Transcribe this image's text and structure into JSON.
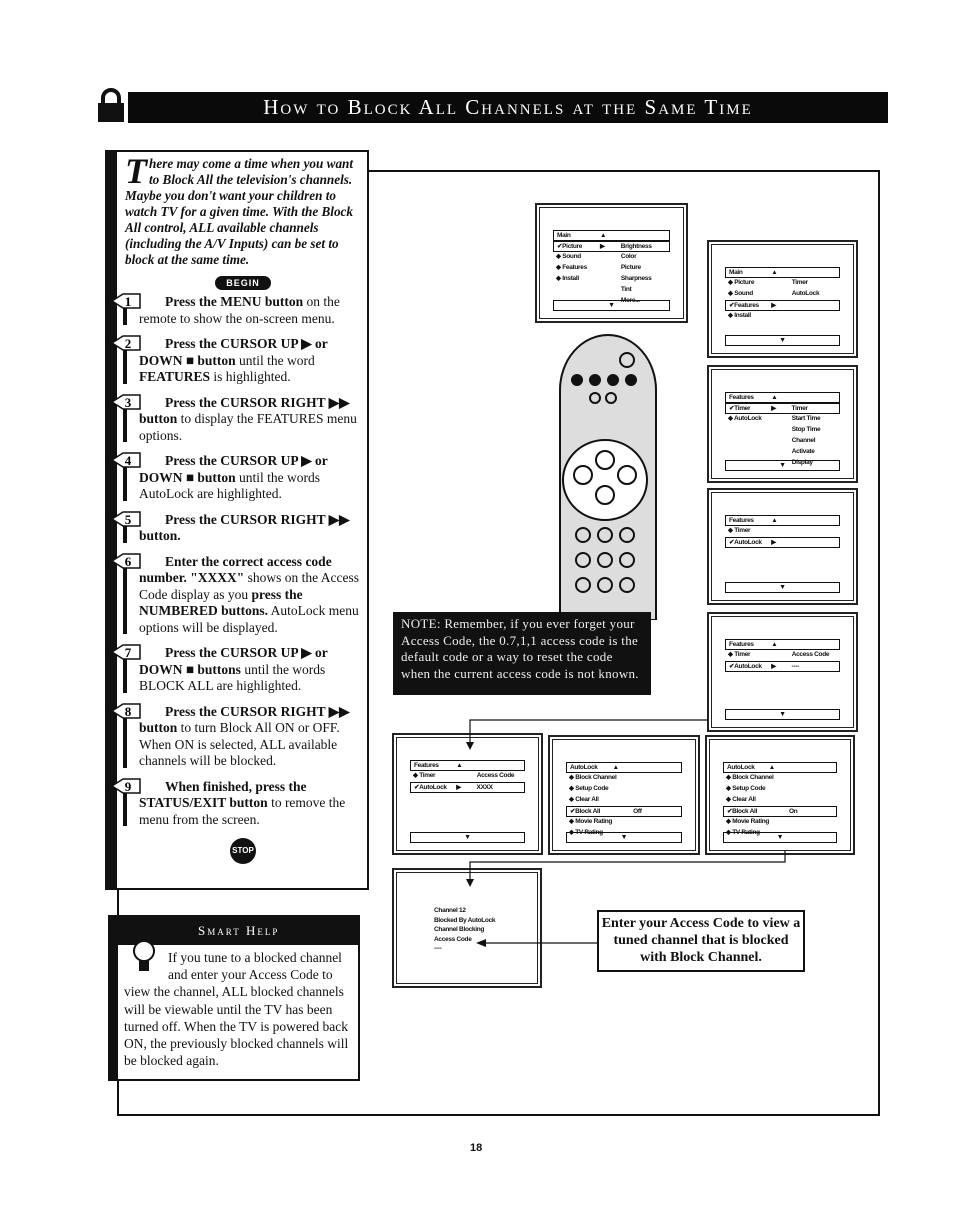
{
  "title": "How to Block All Channels at the Same Time",
  "intro": {
    "drop_cap": "T",
    "text": "here may come a time when you want to Block All the television's channels. Maybe you don't want your children to watch TV for a given time. With the Block All control, ALL available channels (including the A/V Inputs) can be set to block at the same time.",
    "begin_label": "BEGIN"
  },
  "steps": [
    {
      "num": "1",
      "parts": [
        [
          "b",
          "Press the MENU button"
        ],
        [
          "n",
          " on the remote to show the on-screen menu."
        ]
      ]
    },
    {
      "num": "2",
      "parts": [
        [
          "b",
          "Press the CURSOR UP ▶ or DOWN ■ button"
        ],
        [
          "n",
          " until the word "
        ],
        [
          "b",
          "FEATURES"
        ],
        [
          "n",
          " is highlighted."
        ]
      ]
    },
    {
      "num": "3",
      "parts": [
        [
          "b",
          "Press the CURSOR RIGHT ▶▶ button"
        ],
        [
          "n",
          " to display the FEATURES menu options."
        ]
      ]
    },
    {
      "num": "4",
      "parts": [
        [
          "b",
          "Press the CURSOR UP ▶ or DOWN ■ button"
        ],
        [
          "n",
          " until the words AutoLock are highlighted."
        ]
      ]
    },
    {
      "num": "5",
      "parts": [
        [
          "b",
          "Press the CURSOR RIGHT ▶▶ button."
        ]
      ]
    },
    {
      "num": "6",
      "parts": [
        [
          "b",
          "Enter the correct access code number. \"XXXX\""
        ],
        [
          "n",
          " shows on the Access Code display as you "
        ],
        [
          "b",
          "press the NUMBERED buttons."
        ],
        [
          "n",
          " AutoLock menu options will be displayed."
        ]
      ]
    },
    {
      "num": "7",
      "parts": [
        [
          "b",
          "Press the CURSOR UP ▶ or DOWN ■ buttons"
        ],
        [
          "n",
          " until the words BLOCK ALL are highlighted."
        ]
      ]
    },
    {
      "num": "8",
      "parts": [
        [
          "b",
          "Press the CURSOR RIGHT ▶▶ button"
        ],
        [
          "n",
          " to turn Block All ON or OFF. When ON is selected, ALL available channels will be blocked."
        ]
      ]
    },
    {
      "num": "9",
      "parts": [
        [
          "b",
          "When finished, press the STATUS/EXIT button"
        ],
        [
          "n",
          " to remove the menu from the screen."
        ]
      ]
    }
  ],
  "stop_label": "STOP",
  "smart_help": {
    "heading": "Smart Help",
    "text": "If you tune to a blocked channel and enter your Access Code to view the channel, ALL blocked channels will be viewable until the TV has been turned off. When the TV is powered back ON, the previously blocked channels will be blocked again."
  },
  "note": "NOTE: Remember, if you ever forget your Access Code, the 0.7,1,1 access code is the default code or a way to reset the code when the current access code is not known.",
  "callout": "Enter your Access Code to view a tuned channel that is blocked with Block Channel.",
  "screens": [
    {
      "rows": [
        {
          "l": "Main",
          "a": "▲",
          "hl": true
        },
        {
          "l": "✔Picture",
          "a": "▶",
          "r": "Brightness",
          "hl": true
        },
        {
          "l": "◆ Sound",
          "r": "Color"
        },
        {
          "l": "◆ Features",
          "r": "Picture"
        },
        {
          "l": "◆ Install",
          "r": "Sharpness"
        },
        {
          "r": "Tint"
        },
        {
          "r": "More..."
        }
      ]
    },
    {
      "rows": [
        {
          "l": "Main",
          "a": "▲",
          "hl": true
        },
        {
          "l": "◆ Picture",
          "r": "Timer"
        },
        {
          "l": "◆ Sound",
          "r": "AutoLock"
        },
        {
          "l": "✔Features",
          "a": "▶",
          "hl": true
        },
        {
          "l": "◆ Install"
        }
      ]
    },
    {
      "rows": [
        {
          "l": "Features",
          "a": "▲",
          "hl": true
        },
        {
          "l": "✔Timer",
          "a": "▶",
          "r": "Timer",
          "hl": true
        },
        {
          "l": "◆ AutoLock",
          "r": "Start Time"
        },
        {
          "r": "Stop Time"
        },
        {
          "r": "Channel"
        },
        {
          "r": "Activate"
        },
        {
          "r": "Display"
        }
      ]
    },
    {
      "rows": [
        {
          "l": "Features",
          "a": "▲",
          "hl": true
        },
        {
          "l": "◆ Timer"
        },
        {
          "l": "✔AutoLock",
          "a": "▶",
          "hl": true
        }
      ]
    },
    {
      "rows": [
        {
          "l": "Features",
          "a": "▲",
          "hl": true
        },
        {
          "l": "◆ Timer",
          "r": "Access Code"
        },
        {
          "l": "✔AutoLock",
          "a": "▶",
          "r": "----",
          "hl": true
        }
      ]
    },
    {
      "rows": [
        {
          "l": "Features",
          "a": "▲",
          "hl": true
        },
        {
          "l": "◆ Timer",
          "r": "Access Code"
        },
        {
          "l": "✔AutoLock",
          "a": "▶",
          "r": "XXXX",
          "hl": true
        }
      ]
    },
    {
      "rows": [
        {
          "l": "AutoLock",
          "a": "▲",
          "hl": true
        },
        {
          "l": "◆ Block Channel"
        },
        {
          "l": "◆ Setup Code"
        },
        {
          "l": "◆ Clear All"
        },
        {
          "l": "✔Block All",
          "r": "Off",
          "hl": true
        },
        {
          "l": "◆ Movie Rating"
        },
        {
          "l": "◆ TV Rating"
        }
      ]
    },
    {
      "rows": [
        {
          "l": "AutoLock",
          "a": "▲",
          "hl": true
        },
        {
          "l": "◆ Block Channel"
        },
        {
          "l": "◆ Setup Code"
        },
        {
          "l": "◆ Clear All"
        },
        {
          "l": "✔Block All",
          "r": "On",
          "hl": true
        },
        {
          "l": "◆ Movie Rating"
        },
        {
          "l": "◆ TV Rating"
        }
      ]
    }
  ],
  "screen_down_arrow": "▼",
  "blocked_screen": [
    "Channel 12",
    "Blocked By AutoLock",
    "Channel Blocking",
    "Access Code",
    "----"
  ],
  "page_number": "18"
}
